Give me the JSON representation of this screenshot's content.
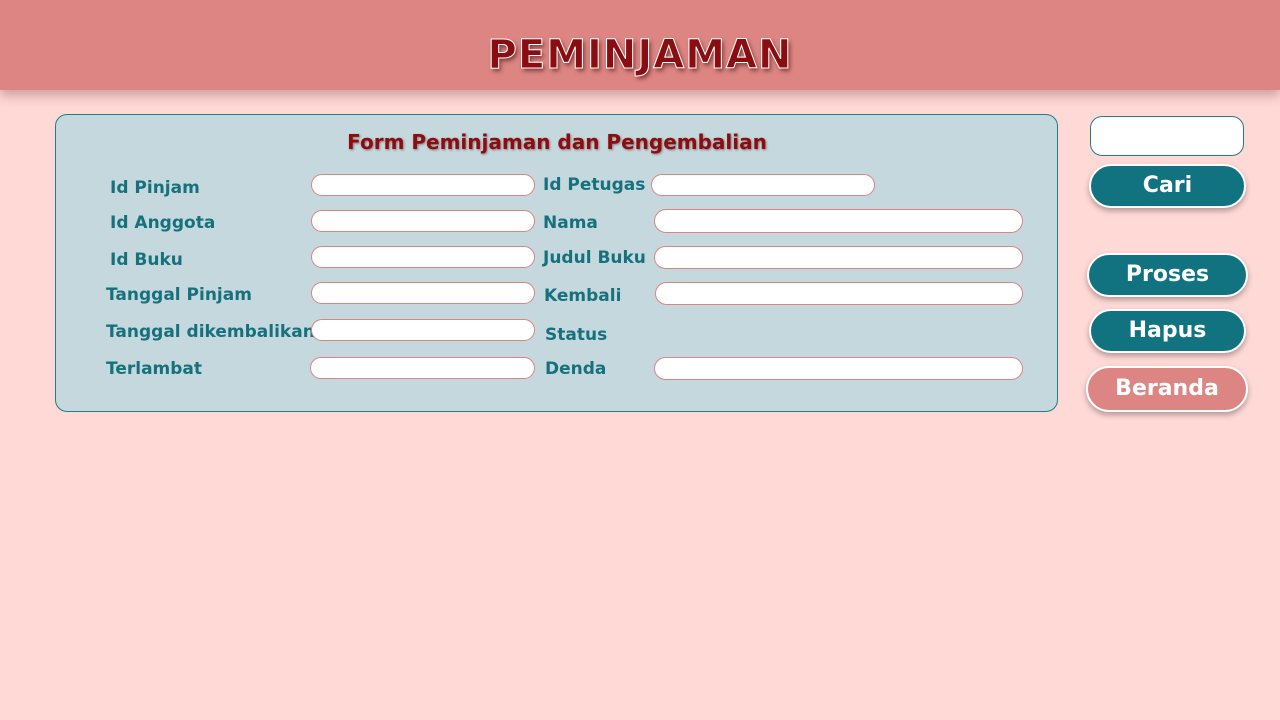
{
  "header": {
    "title": "PEMINJAMAN"
  },
  "form": {
    "title": "Form Peminjaman dan Pengembalian",
    "left_labels": {
      "id_pinjam": "Id Pinjam",
      "id_anggota": "Id Anggota",
      "id_buku": "Id Buku",
      "tanggal_pinjam": "Tanggal Pinjam",
      "tanggal_dikembalikan": "Tanggal dikembalikan",
      "terlambat": "Terlambat"
    },
    "right_labels": {
      "id_petugas": "Id Petugas",
      "nama": "Nama",
      "judul_buku": "Judul Buku",
      "kembali": "Kembali",
      "status": "Status",
      "denda": "Denda"
    },
    "values": {
      "id_pinjam": "",
      "id_anggota": "",
      "id_buku": "",
      "tanggal_pinjam": "",
      "tanggal_dikembalikan": "",
      "terlambat": "",
      "id_petugas": "",
      "nama": "",
      "judul_buku": "",
      "kembali": "",
      "denda": ""
    }
  },
  "sidebar": {
    "search_value": "",
    "cari_label": "Cari",
    "proses_label": "Proses",
    "hapus_label": "Hapus",
    "beranda_label": "Beranda"
  },
  "colors": {
    "background": "#ffd9d6",
    "header": "#dc8582",
    "title": "#8a0d12",
    "panel": "#c4d8dd",
    "label": "#17717d",
    "button_teal": "#127380",
    "button_pink": "#dc8582",
    "field_border": "#d98583"
  }
}
